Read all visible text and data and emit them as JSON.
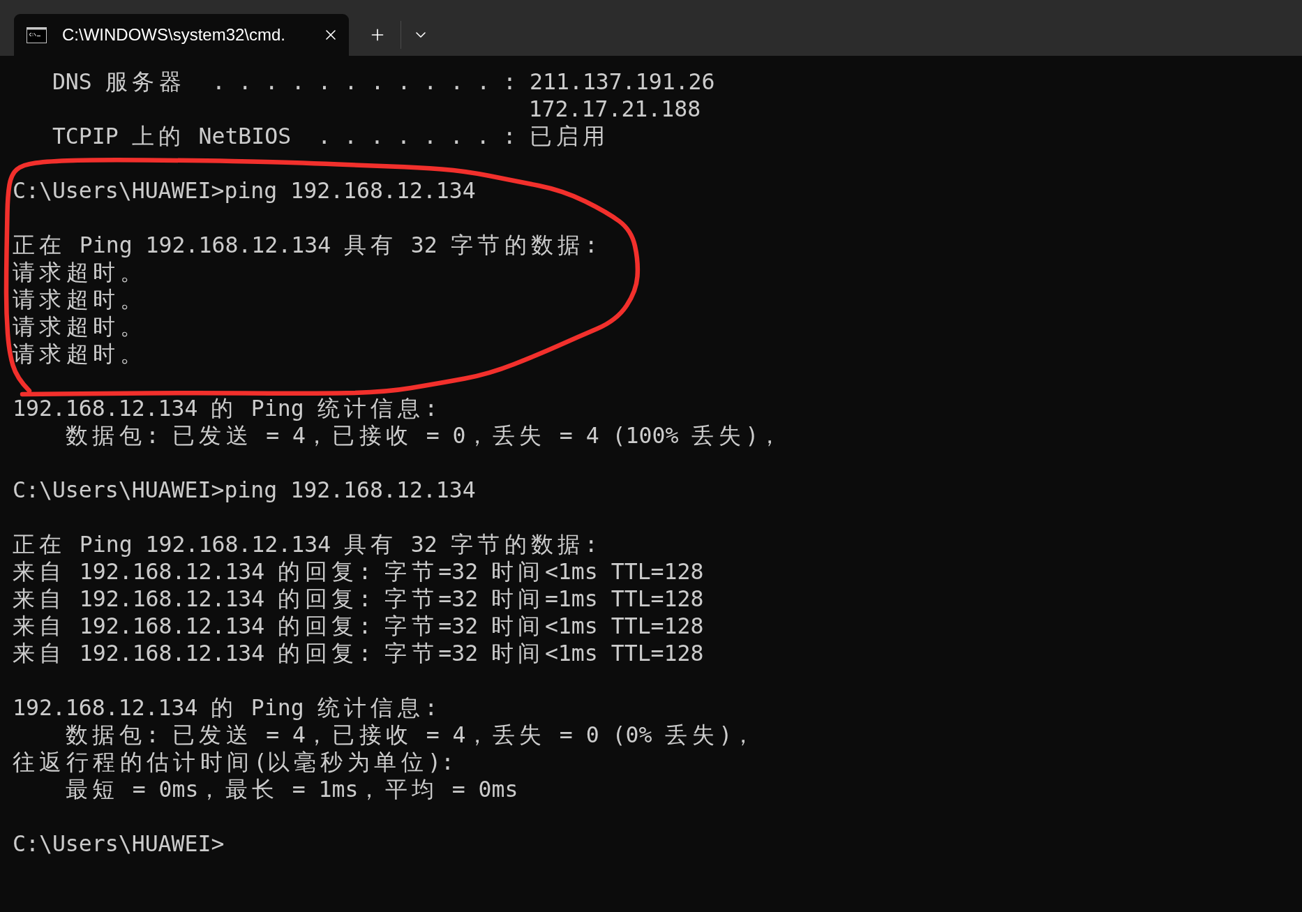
{
  "window": {
    "tabs": [
      {
        "title": "C:\\WINDOWS\\system32\\cmd.",
        "selected": true
      }
    ]
  },
  "terminal": {
    "blocks": [
      [
        "   DNS 服务器  . . . . . . . . . . . : 211.137.191.26",
        "                                       172.17.21.188",
        "   TCPIP 上的 NetBIOS  . . . . . . . : 已启用"
      ],
      [
        "C:\\Users\\HUAWEI>ping 192.168.12.134"
      ],
      [
        "正在 Ping 192.168.12.134 具有 32 字节的数据:",
        "请求超时。",
        "请求超时。",
        "请求超时。",
        "请求超时。"
      ],
      [
        "192.168.12.134 的 Ping 统计信息:",
        "    数据包: 已发送 = 4，已接收 = 0，丢失 = 4 (100% 丢失)，"
      ],
      [
        "C:\\Users\\HUAWEI>ping 192.168.12.134"
      ],
      [
        "正在 Ping 192.168.12.134 具有 32 字节的数据:",
        "来自 192.168.12.134 的回复: 字节=32 时间<1ms TTL=128",
        "来自 192.168.12.134 的回复: 字节=32 时间=1ms TTL=128",
        "来自 192.168.12.134 的回复: 字节=32 时间<1ms TTL=128",
        "来自 192.168.12.134 的回复: 字节=32 时间<1ms TTL=128"
      ],
      [
        "192.168.12.134 的 Ping 统计信息:",
        "    数据包: 已发送 = 4，已接收 = 4，丢失 = 0 (0% 丢失)，",
        "往返行程的估计时间(以毫秒为单位):",
        "    最短 = 0ms，最长 = 1ms，平均 = 0ms"
      ],
      [
        "C:\\Users\\HUAWEI>"
      ]
    ]
  }
}
